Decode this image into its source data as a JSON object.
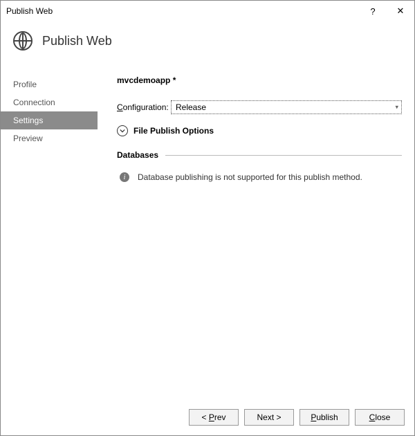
{
  "window": {
    "title": "Publish Web",
    "help": "?",
    "close": "✕"
  },
  "header": {
    "title": "Publish Web"
  },
  "nav": {
    "items": [
      {
        "label": "Profile",
        "active": false
      },
      {
        "label": "Connection",
        "active": false
      },
      {
        "label": "Settings",
        "active": true
      },
      {
        "label": "Preview",
        "active": false
      }
    ]
  },
  "content": {
    "profile_name": "mvcdemoapp *",
    "config_label_prefix": "C",
    "config_label_rest": "onfiguration:",
    "config_value": "Release",
    "file_publish_label": "File Publish Options",
    "databases_label": "Databases",
    "db_info": "Database publishing is not supported for this publish method."
  },
  "footer": {
    "prev_prefix": "< ",
    "prev_u": "P",
    "prev_rest": "rev",
    "next_text": "Next >",
    "publish_u": "P",
    "publish_rest": "ublish",
    "close_u": "C",
    "close_rest": "lose"
  }
}
